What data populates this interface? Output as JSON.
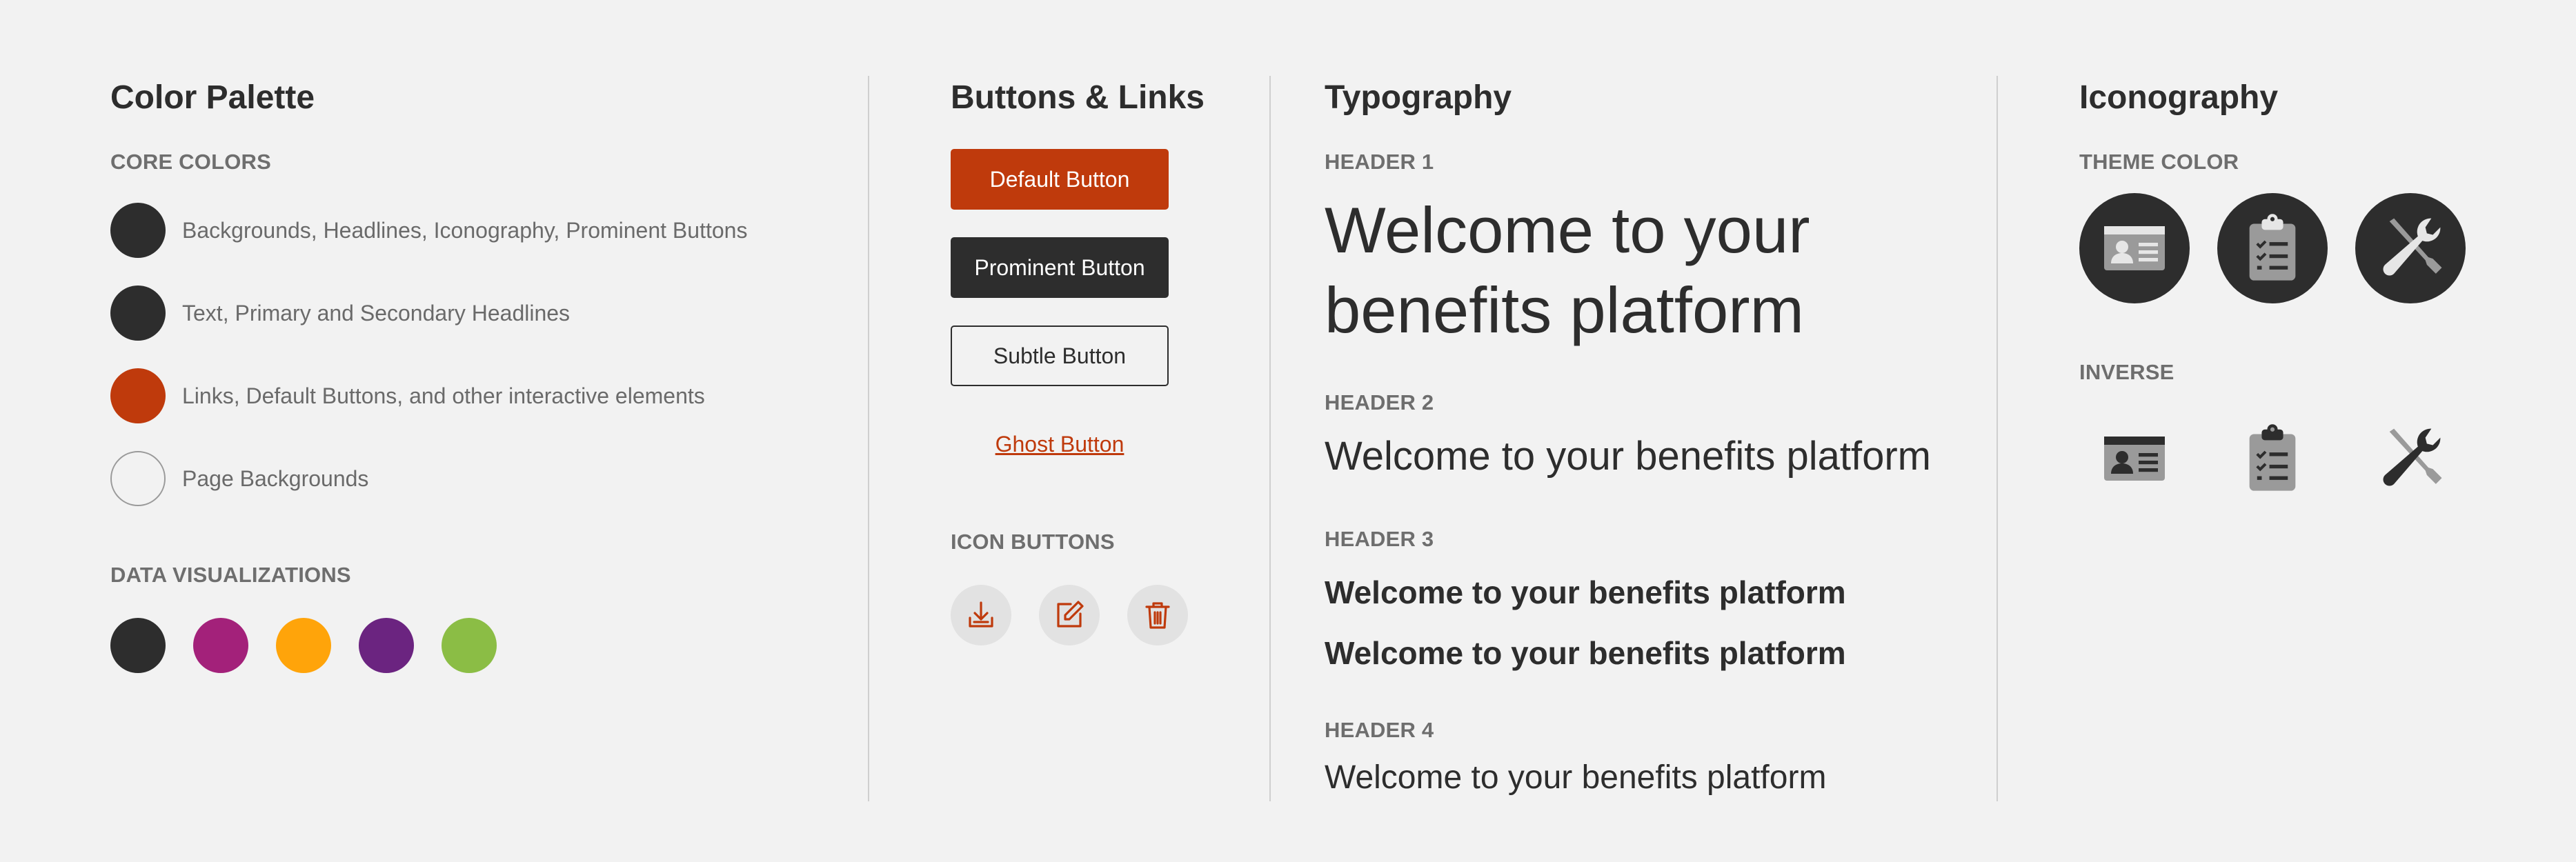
{
  "palette": {
    "title": "Color Palette",
    "core_label": "CORE COLORS",
    "core_colors": [
      {
        "color": "#2d2d2d",
        "label": "Backgrounds, Headlines, Iconography, Prominent Buttons"
      },
      {
        "color": "#2d2d2d",
        "label": "Text, Primary and Secondary Headlines"
      },
      {
        "color": "#bf3a0c",
        "label": "Links, Default Buttons, and other interactive elements"
      },
      {
        "color": "#f2f2f2",
        "label": "Page Backgrounds"
      }
    ],
    "viz_label": "DATA VISUALIZATIONS",
    "viz_colors": [
      "#2d2d2d",
      "#a3217a",
      "#ffa40a",
      "#6b2480",
      "#8bbd45"
    ]
  },
  "buttons": {
    "title": "Buttons & Links",
    "default_label": "Default Button",
    "prominent_label": "Prominent Button",
    "subtle_label": "Subtle Button",
    "ghost_label": "Ghost Button",
    "icon_buttons_label": "ICON BUTTONS",
    "icon_buttons": [
      "download-icon",
      "edit-icon",
      "trash-icon"
    ]
  },
  "typography": {
    "title": "Typography",
    "h1_label": "HEADER 1",
    "h1_text": "Welcome to your benefits platform",
    "h2_label": "HEADER 2",
    "h2_text": "Welcome to your benefits platform",
    "h3_label": "HEADER 3",
    "h3_text_a": "Welcome to your benefits platform",
    "h3_text_b": "Welcome to your benefits platform",
    "h4_label": "HEADER 4",
    "h4_text": "Welcome to your benefits platform"
  },
  "iconography": {
    "title": "Iconography",
    "theme_label": "THEME COLOR",
    "inverse_label": "INVERSE",
    "icons": [
      "id-card-icon",
      "clipboard-checklist-icon",
      "wrench-screwdriver-icon"
    ]
  }
}
